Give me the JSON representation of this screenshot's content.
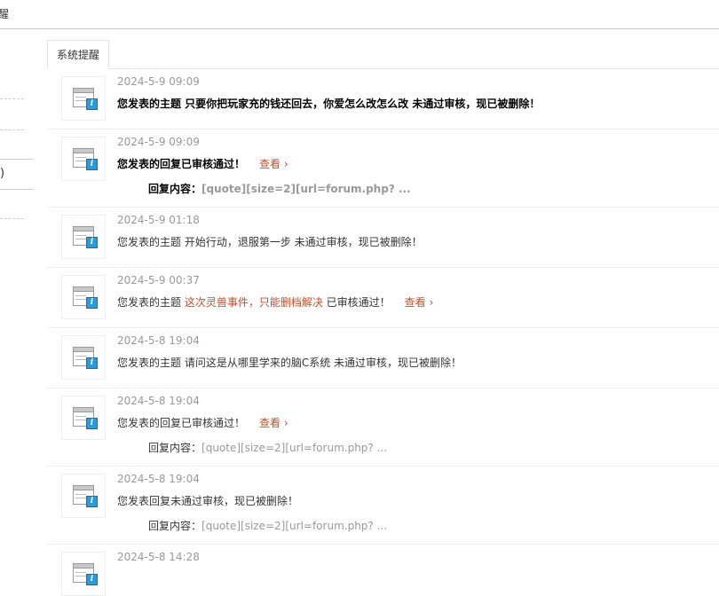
{
  "header": {
    "crumb": "醒"
  },
  "sidebar": {
    "paren": ")"
  },
  "tabs": [
    {
      "label": "系统提醒"
    }
  ],
  "notices": [
    {
      "time": "2024-5-9 09:09",
      "prefix": "您发表的主题 只要你把玩家充的钱还回去，你爱怎么改怎么改 未通过审核，现已被删除！",
      "bold": true
    },
    {
      "time": "2024-5-9 09:09",
      "prefix": "您发表的回复已审核通过！",
      "view": "查看 ›",
      "bold": true,
      "reply_label": "回复内容：",
      "reply_quote": "[quote][size=2][url=forum.php? ..."
    },
    {
      "time": "2024-5-9 01:18",
      "prefix": "您发表的主题 开始行动，退服第一步 未通过审核，现已被删除！"
    },
    {
      "time": "2024-5-9 00:37",
      "prefix": "您发表的主题 ",
      "highlight": "这次灵兽事件，只能删档解决",
      "suffix": " 已审核通过！",
      "view": "查看 ›"
    },
    {
      "time": "2024-5-8 19:04",
      "prefix": "您发表的主题 请问这是从哪里学来的脑C系统 未通过审核，现已被删除！"
    },
    {
      "time": "2024-5-8 19:04",
      "prefix": "您发表的回复已审核通过！",
      "view": "查看 ›",
      "reply_label": "回复内容：",
      "reply_quote": "[quote][size=2][url=forum.php? ..."
    },
    {
      "time": "2024-5-8 19:04",
      "prefix": "您发表回复未通过审核，现已被删除！",
      "reply_label": "回复内容：",
      "reply_quote": "[quote][size=2][url=forum.php? ..."
    },
    {
      "time": "2024-5-8 14:28"
    }
  ],
  "colors": {
    "accent": "#c0502a",
    "muted": "#999999",
    "info_icon": "#2a9ad9"
  },
  "icons": {
    "notice": "system-notice-icon"
  }
}
